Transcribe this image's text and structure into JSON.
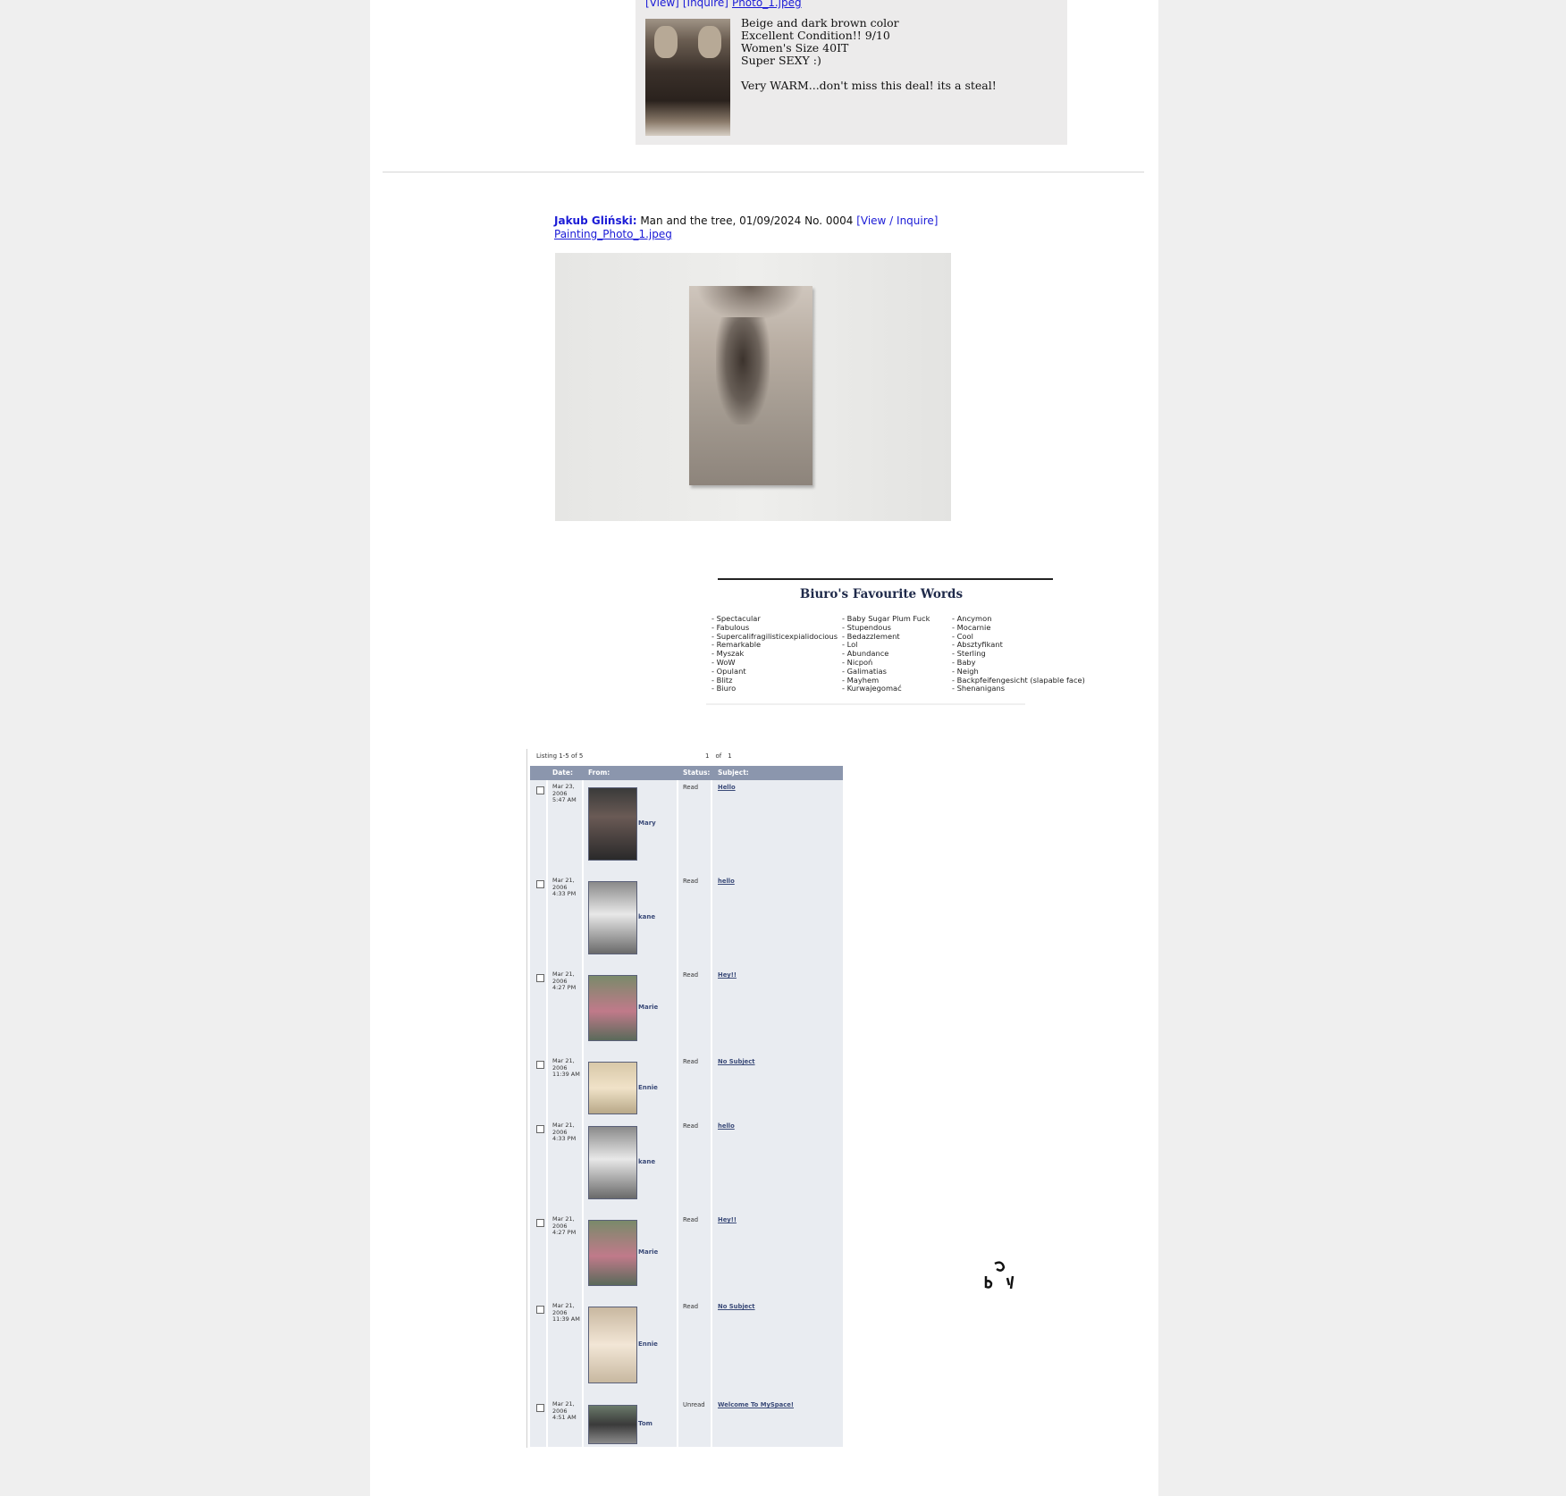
{
  "top_listing": {
    "links": [
      "[View]",
      "[Inquire]",
      "Photo_1.jpeg"
    ],
    "description": [
      "Beige and dark brown color",
      "Excellent Condition!! 9/10",
      "Women's Size 40IT",
      "Super SEXY :)",
      "",
      "Very WARM...don't miss this deal! its a steal!"
    ]
  },
  "painting_listing": {
    "artist": "Jakub Gliński:",
    "title": " Man and the tree, 01/09/2024 No. 0004 ",
    "inquire": "[View / Inquire]",
    "file": "Painting_Photo_1.jpeg"
  },
  "favourite_words": {
    "title": "Biuro's Favourite Words",
    "col1": [
      "- Spectacular",
      "- Fabulous",
      "- Supercalifragilisticexpialidocious",
      "- Remarkable",
      "- Myszak",
      "- WoW",
      "- Opulant",
      "- Blitz",
      "- Biuro"
    ],
    "col2": [
      "- Baby Sugar Plum Fuck",
      "- Stupendous",
      "- Bedazzlement",
      "- Lol",
      "- Abundance",
      "- Nicpoń",
      "- Galimatias",
      "- Mayhem",
      "- Kurwajegomać"
    ],
    "col3": [
      "- Ancymon",
      "- Mocarnie",
      "- Cool",
      "- Absztyfikant",
      "- Sterling",
      "- Baby",
      "- Neigh",
      "- Backpfeifengesicht (slapable face)",
      "- Shenanigans"
    ]
  },
  "inbox": {
    "listing": "Listing 1-5 of 5",
    "pager": [
      "1",
      "of",
      "1"
    ],
    "headers": {
      "date": "Date:",
      "from": "From:",
      "status": "Status:",
      "subject": "Subject:"
    },
    "rows": [
      {
        "date": [
          "Mar 23,",
          "2006",
          "5:47 AM"
        ],
        "from": "Mary",
        "status": "Read",
        "subject": "Hello"
      },
      {
        "date": [
          "Mar 21,",
          "2006",
          "4:33 PM"
        ],
        "from": "kane",
        "status": "Read",
        "subject": "hello"
      },
      {
        "date": [
          "Mar 21,",
          "2006",
          "4:27 PM"
        ],
        "from": "Marie",
        "status": "Read",
        "subject": "Hey!!"
      },
      {
        "date": [
          "Mar 21,",
          "2006",
          "11:39 AM"
        ],
        "from": "Ennie",
        "status": "Read",
        "subject": "No Subject"
      },
      {
        "date": [
          "Mar 21,",
          "2006",
          "4:33 PM"
        ],
        "from": "kane",
        "status": "Read",
        "subject": "hello"
      },
      {
        "date": [
          "Mar 21,",
          "2006",
          "4:27 PM"
        ],
        "from": "Marie",
        "status": "Read",
        "subject": "Hey!!"
      },
      {
        "date": [
          "Mar 21,",
          "2006",
          "11:39 AM"
        ],
        "from": "Ennie",
        "status": "Read",
        "subject": "No Subject"
      },
      {
        "date": [
          "Mar 21,",
          "2006",
          "4:51 AM"
        ],
        "from": "Tom",
        "status": "Unread",
        "subject": "Welcome To MySpace!"
      }
    ]
  },
  "colors": {
    "link": "#1a1ad6",
    "table_header": "#8b96ad",
    "row_bg": "#e9ecf1",
    "name": "#3a4a78"
  }
}
